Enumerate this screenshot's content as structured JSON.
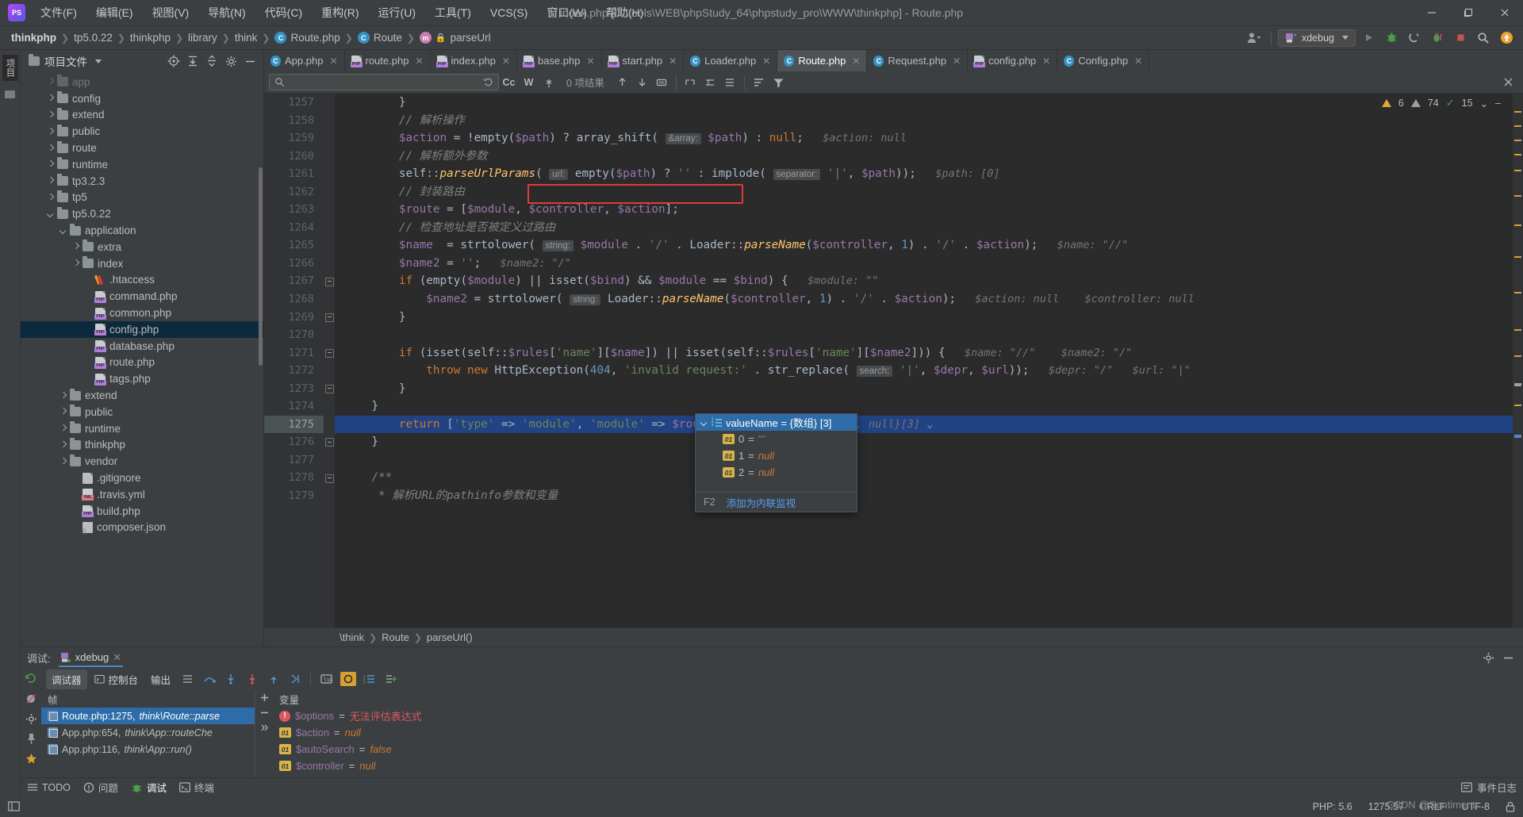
{
  "window": {
    "title": "index.php [D:\\tools\\WEB\\phpStudy_64\\phpstudy_pro\\WWW\\thinkphp] - Route.php",
    "minimize": "–",
    "maximize": "❐",
    "close": "✕"
  },
  "menu": [
    "文件(F)",
    "编辑(E)",
    "视图(V)",
    "导航(N)",
    "代码(C)",
    "重构(R)",
    "运行(U)",
    "工具(T)",
    "VCS(S)",
    "窗口(W)",
    "帮助(H)"
  ],
  "breadcrumbs": [
    {
      "label": "thinkphp",
      "icon": "none",
      "bold": true
    },
    {
      "label": "tp5.0.22",
      "icon": "none",
      "bold": false
    },
    {
      "label": "thinkphp",
      "icon": "none",
      "bold": false
    },
    {
      "label": "library",
      "icon": "none",
      "bold": false
    },
    {
      "label": "think",
      "icon": "none",
      "bold": false
    },
    {
      "label": "Route.php",
      "icon": "class",
      "bold": false
    },
    {
      "label": "Route",
      "icon": "class",
      "bold": false
    },
    {
      "label": "parseUrl",
      "icon": "method",
      "bold": false
    }
  ],
  "toolbar": {
    "run_config": "xdebug",
    "run": "run-icon",
    "debug": "debug-icon",
    "coverage": "coverage-icon",
    "profile": "profile-icon",
    "stop": "stop-icon",
    "search": "search-icon",
    "updates": "update-icon"
  },
  "project_panel": {
    "title": "项目文件",
    "tree": [
      {
        "label": "app",
        "depth": 2,
        "type": "folder",
        "arrow": "right",
        "selected": false,
        "partial": true
      },
      {
        "label": "config",
        "depth": 2,
        "type": "folder",
        "arrow": "right",
        "selected": false
      },
      {
        "label": "extend",
        "depth": 2,
        "type": "folder",
        "arrow": "right",
        "selected": false
      },
      {
        "label": "public",
        "depth": 2,
        "type": "folder",
        "arrow": "right",
        "selected": false
      },
      {
        "label": "route",
        "depth": 2,
        "type": "folder",
        "arrow": "right",
        "selected": false
      },
      {
        "label": "runtime",
        "depth": 2,
        "type": "folder",
        "arrow": "right",
        "selected": false
      },
      {
        "label": "tp3.2.3",
        "depth": 2,
        "type": "folder",
        "arrow": "right",
        "selected": false
      },
      {
        "label": "tp5",
        "depth": 2,
        "type": "folder",
        "arrow": "right",
        "selected": false
      },
      {
        "label": "tp5.0.22",
        "depth": 2,
        "type": "folder",
        "arrow": "down",
        "selected": false
      },
      {
        "label": "application",
        "depth": 3,
        "type": "folder",
        "arrow": "down",
        "selected": false
      },
      {
        "label": "extra",
        "depth": 4,
        "type": "folder",
        "arrow": "right",
        "selected": false
      },
      {
        "label": "index",
        "depth": 4,
        "type": "folder",
        "arrow": "right",
        "selected": false
      },
      {
        "label": ".htaccess",
        "depth": 5,
        "type": "htaccess",
        "arrow": "none",
        "selected": false
      },
      {
        "label": "command.php",
        "depth": 5,
        "type": "php",
        "arrow": "none",
        "selected": false
      },
      {
        "label": "common.php",
        "depth": 5,
        "type": "php",
        "arrow": "none",
        "selected": false
      },
      {
        "label": "config.php",
        "depth": 5,
        "type": "php",
        "arrow": "none",
        "selected": true
      },
      {
        "label": "database.php",
        "depth": 5,
        "type": "php",
        "arrow": "none",
        "selected": false
      },
      {
        "label": "route.php",
        "depth": 5,
        "type": "php",
        "arrow": "none",
        "selected": false
      },
      {
        "label": "tags.php",
        "depth": 5,
        "type": "php",
        "arrow": "none",
        "selected": false
      },
      {
        "label": "extend",
        "depth": 3,
        "type": "folder",
        "arrow": "right",
        "selected": false
      },
      {
        "label": "public",
        "depth": 3,
        "type": "folder",
        "arrow": "right",
        "selected": false
      },
      {
        "label": "runtime",
        "depth": 3,
        "type": "folder",
        "arrow": "right",
        "selected": false
      },
      {
        "label": "thinkphp",
        "depth": 3,
        "type": "folder",
        "arrow": "right",
        "selected": false
      },
      {
        "label": "vendor",
        "depth": 3,
        "type": "folder",
        "arrow": "right",
        "selected": false
      },
      {
        "label": ".gitignore",
        "depth": 4,
        "type": "gitignore",
        "arrow": "none",
        "selected": false
      },
      {
        "label": ".travis.yml",
        "depth": 4,
        "type": "yml",
        "arrow": "none",
        "selected": false
      },
      {
        "label": "build.php",
        "depth": 4,
        "type": "php",
        "arrow": "none",
        "selected": false
      },
      {
        "label": "composer.json",
        "depth": 4,
        "type": "json",
        "arrow": "none",
        "selected": false
      }
    ]
  },
  "editor_tabs": [
    {
      "label": "App.php",
      "icon": "class",
      "active": false
    },
    {
      "label": "route.php",
      "icon": "php",
      "active": false
    },
    {
      "label": "index.php",
      "icon": "php",
      "active": false
    },
    {
      "label": "base.php",
      "icon": "php",
      "active": false
    },
    {
      "label": "start.php",
      "icon": "php",
      "active": false
    },
    {
      "label": "Loader.php",
      "icon": "class",
      "active": false
    },
    {
      "label": "Route.php",
      "icon": "class",
      "active": true
    },
    {
      "label": "Request.php",
      "icon": "class",
      "active": false
    },
    {
      "label": "config.php",
      "icon": "php",
      "active": false
    },
    {
      "label": "Config.php",
      "icon": "class",
      "active": false
    }
  ],
  "find_bar": {
    "placeholder": "",
    "results": "0 项结果",
    "case_btn": "Cc",
    "word_btn": "W",
    "regex_btn": ".*"
  },
  "inspections": {
    "warnings": "6",
    "weak_warnings": "74",
    "checks": "15"
  },
  "code": {
    "first_line": 1257,
    "lines": [
      {
        "n": 1257,
        "fold": false,
        "highlight": false
      },
      {
        "n": 1258,
        "fold": false,
        "highlight": false
      },
      {
        "n": 1259,
        "fold": false,
        "highlight": false
      },
      {
        "n": 1260,
        "fold": false,
        "highlight": false
      },
      {
        "n": 1261,
        "fold": false,
        "highlight": false
      },
      {
        "n": 1262,
        "fold": false,
        "highlight": false
      },
      {
        "n": 1263,
        "fold": false,
        "highlight": false
      },
      {
        "n": 1264,
        "fold": false,
        "highlight": false
      },
      {
        "n": 1265,
        "fold": false,
        "highlight": false
      },
      {
        "n": 1266,
        "fold": false,
        "highlight": false
      },
      {
        "n": 1267,
        "fold": true,
        "highlight": false
      },
      {
        "n": 1268,
        "fold": false,
        "highlight": false
      },
      {
        "n": 1269,
        "fold": true,
        "highlight": false
      },
      {
        "n": 1270,
        "fold": false,
        "highlight": false
      },
      {
        "n": 1271,
        "fold": true,
        "highlight": false
      },
      {
        "n": 1272,
        "fold": false,
        "highlight": false
      },
      {
        "n": 1273,
        "fold": true,
        "highlight": false
      },
      {
        "n": 1274,
        "fold": false,
        "highlight": false
      },
      {
        "n": 1275,
        "fold": false,
        "highlight": true
      },
      {
        "n": 1276,
        "fold": true,
        "highlight": false
      },
      {
        "n": 1277,
        "fold": false,
        "highlight": false
      },
      {
        "n": 1278,
        "fold": true,
        "highlight": false
      },
      {
        "n": 1279,
        "fold": false,
        "highlight": false
      }
    ],
    "text_lines": [
      "}",
      "// 解析操作",
      "$action = !empty($path) ? array_shift( &array: $path) : null;    $action: null",
      "// 解析额外参数",
      "self::parseUrlParams( url: empty($path) ? '' : implode( separator: '|', $path));    $path: [0]",
      "// 封装路由",
      "$route = [$module, $controller, $action];",
      "// 检查地址是否被定义过路由",
      "$name  = strtolower( string: $module . '/' . Loader::parseName($controller, 1) . '/' . $action);   $name: \"//\"",
      "$name2 = '';   $name2: \"/\"",
      "if (empty($module) || isset($bind) && $module == $bind) {   $module: \"\"",
      "$name2 = strtolower( string: Loader::parseName($controller, 1) . '/' . $action);   $action: null    $controller: null",
      "}",
      "",
      "if (isset(self::$rules['name'][$name]) || isset(self::$rules['name'][$name2])) {   $name: \"//\"    $name2: \"/\"",
      "throw new HttpException(404, 'invalid request:' . str_replace( search: '|', $depr, $url));   $depr: \"/\"   $url: \"|\"",
      "}",
      "}",
      "return ['type' => 'module', 'module' => $route];   $route: {\"\", null, null}[3]",
      "}",
      "",
      "/**",
      " * 解析URL的pathinfo参数和变量"
    ]
  },
  "debug_popup": {
    "header": "valueName = {数组} [3]",
    "items": [
      {
        "index": "0",
        "value": "\"\"",
        "kind": "string"
      },
      {
        "index": "1",
        "value": "null",
        "kind": "null"
      },
      {
        "index": "2",
        "value": "null",
        "kind": "null"
      }
    ],
    "footer_key": "F2",
    "footer_action": "添加为内联监视"
  },
  "editor_breadcrumbs": [
    "\\think",
    "Route",
    "parseUrl()"
  ],
  "debug_window": {
    "label": "调试:",
    "session_tab": "xdebug",
    "tabs": [
      {
        "label": "调试器",
        "active": true,
        "icon": "debugger-icon"
      },
      {
        "label": "控制台",
        "active": false,
        "icon": "console-icon"
      },
      {
        "label": "输出",
        "active": false,
        "icon": "output-icon"
      }
    ],
    "frames_header": "帧",
    "variables_header": "变量",
    "frames": [
      {
        "label": "Route.php:1275,",
        "suffix": "think\\Route::parse",
        "selected": true
      },
      {
        "label": "App.php:654,",
        "suffix": "think\\App::routeChe",
        "selected": false
      },
      {
        "label": "App.php:116,",
        "suffix": "think\\App::run()",
        "selected": false
      }
    ],
    "variables": [
      {
        "name": "$options",
        "value": "无法评估表达式",
        "kind": "error"
      },
      {
        "name": "$action",
        "value": "null",
        "kind": "null"
      },
      {
        "name": "$autoSearch",
        "value": "false",
        "kind": "bool"
      },
      {
        "name": "$controller",
        "value": "null",
        "kind": "null"
      }
    ]
  },
  "bottom_bar": {
    "items": [
      {
        "label": "TODO",
        "icon": "todo-icon",
        "active": false
      },
      {
        "label": "问题",
        "icon": "problems-icon",
        "active": false
      },
      {
        "label": "调试",
        "icon": "debug-icon",
        "active": true
      },
      {
        "label": "终端",
        "icon": "terminal-icon",
        "active": false
      }
    ],
    "event_log": "事件日志"
  },
  "status_bar": {
    "php_version": "PHP: 5.6",
    "caret": "1275:57",
    "line_sep": "CRLF",
    "encoding": "UTF-8",
    "watermark": "CSDN @Sentiment"
  }
}
